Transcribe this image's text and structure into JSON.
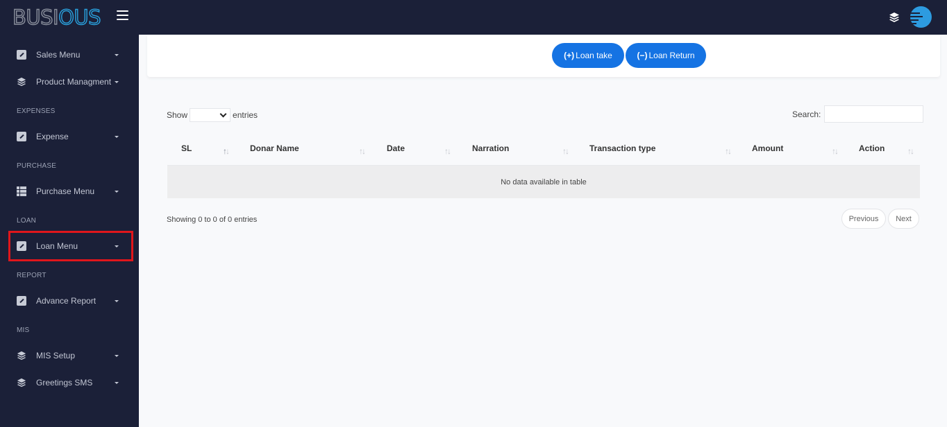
{
  "topbar": {
    "logo_part1": "BUSI",
    "logo_part2": "OUS",
    "icons": [
      "menu-icon",
      "layers-icon",
      "user-avatar"
    ]
  },
  "sidebar": {
    "items": [
      {
        "label": "Sales Menu",
        "icon": "edit-icon"
      },
      {
        "label": "Product Managment",
        "icon": "layers-icon"
      },
      {
        "heading": "EXPENSES"
      },
      {
        "label": "Expense",
        "icon": "edit-icon"
      },
      {
        "heading": "PURCHASE"
      },
      {
        "label": "Purchase Menu",
        "icon": "table-icon"
      },
      {
        "heading": "LOAN"
      },
      {
        "label": "Loan Menu",
        "icon": "edit-icon",
        "highlighted": true
      },
      {
        "heading": "REPORT"
      },
      {
        "label": "Advance Report",
        "icon": "edit-icon"
      },
      {
        "heading": "MIS"
      },
      {
        "label": "MIS Setup",
        "icon": "layers-icon"
      },
      {
        "label": "Greetings SMS",
        "icon": "layers-icon"
      }
    ]
  },
  "actions": {
    "loan_take": {
      "symbol": "(+)",
      "label": "Loan take"
    },
    "loan_return": {
      "symbol": "(−)",
      "label": "Loan Return"
    },
    "accent_color": "#1573e3"
  },
  "table_controls": {
    "show_label": "Show",
    "entries_label": "entries",
    "page_length_value": "",
    "search_label": "Search:",
    "search_value": ""
  },
  "table": {
    "columns": [
      "SL",
      "Donar Name",
      "Date",
      "Narration",
      "Transaction type",
      "Amount",
      "Action"
    ],
    "sort_icon": "↑↓",
    "rows": [],
    "empty_message": "No data available in table"
  },
  "footer": {
    "info": "Showing 0 to 0 of 0 entries",
    "previous": "Previous",
    "next": "Next"
  },
  "highlight_color": "#e0161b"
}
